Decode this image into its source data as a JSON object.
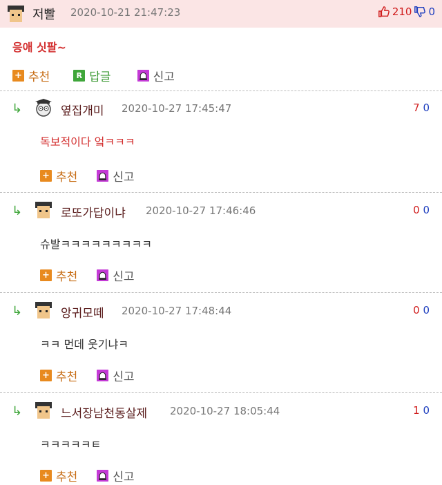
{
  "top": {
    "nickname": "저빨",
    "date": "2020-10-21 21:47:23",
    "upvotes": "210",
    "downvotes": "0",
    "body": "응애 싯팔~",
    "actions": {
      "recommend": "추천",
      "reply": "답글",
      "report": "신고"
    },
    "reply_badge": "R"
  },
  "replies": [
    {
      "nickname": "옆집개미",
      "date": "2020-10-27 17:45:47",
      "up": "7",
      "down": "0",
      "body": "독보적이다 엌ㅋㅋㅋ",
      "recommend": "추천",
      "report": "신고"
    },
    {
      "nickname": "로또가답이냐",
      "date": "2020-10-27 17:46:46",
      "up": "0",
      "down": "0",
      "body": "슈발ㅋㅋㅋㅋㅋㅋㅋㅋㅋ",
      "recommend": "추천",
      "report": "신고"
    },
    {
      "nickname": "앙귀모떼",
      "date": "2020-10-27 17:48:44",
      "up": "0",
      "down": "0",
      "body": "ㅋㅋ 먼데 웃기냐ㅋ",
      "recommend": "추천",
      "report": "신고"
    },
    {
      "nickname": "느서장남천동살제",
      "date": "2020-10-27 18:05:44",
      "up": "1",
      "down": "0",
      "body": "ㅋㅋㅋㅋㅋㅌ",
      "recommend": "추천",
      "report": "신고"
    }
  ],
  "colors": {
    "header_bg": "#fbe5e5",
    "up": "#d01c1c",
    "down": "#1f3fbf",
    "recommend": "#c66b12",
    "reply": "#3e9b36"
  }
}
